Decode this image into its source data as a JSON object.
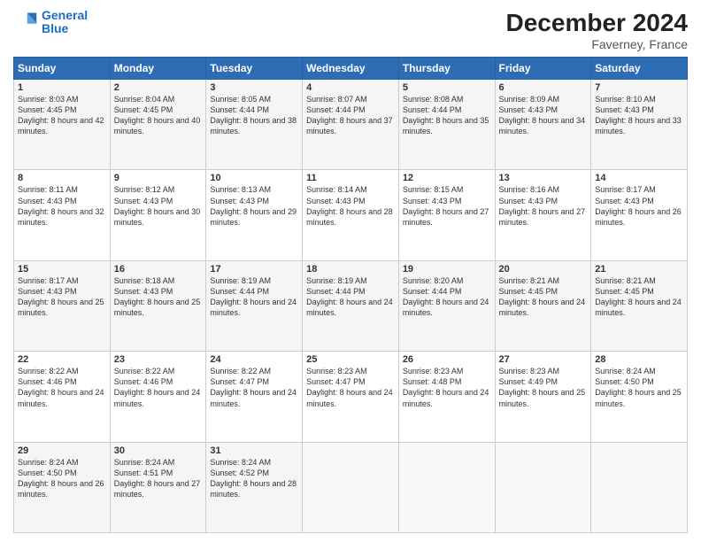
{
  "logo": {
    "line1": "General",
    "line2": "Blue"
  },
  "title": "December 2024",
  "subtitle": "Faverney, France",
  "header_days": [
    "Sunday",
    "Monday",
    "Tuesday",
    "Wednesday",
    "Thursday",
    "Friday",
    "Saturday"
  ],
  "weeks": [
    [
      {
        "day": "1",
        "sunrise": "Sunrise: 8:03 AM",
        "sunset": "Sunset: 4:45 PM",
        "daylight": "Daylight: 8 hours and 42 minutes."
      },
      {
        "day": "2",
        "sunrise": "Sunrise: 8:04 AM",
        "sunset": "Sunset: 4:45 PM",
        "daylight": "Daylight: 8 hours and 40 minutes."
      },
      {
        "day": "3",
        "sunrise": "Sunrise: 8:05 AM",
        "sunset": "Sunset: 4:44 PM",
        "daylight": "Daylight: 8 hours and 38 minutes."
      },
      {
        "day": "4",
        "sunrise": "Sunrise: 8:07 AM",
        "sunset": "Sunset: 4:44 PM",
        "daylight": "Daylight: 8 hours and 37 minutes."
      },
      {
        "day": "5",
        "sunrise": "Sunrise: 8:08 AM",
        "sunset": "Sunset: 4:44 PM",
        "daylight": "Daylight: 8 hours and 35 minutes."
      },
      {
        "day": "6",
        "sunrise": "Sunrise: 8:09 AM",
        "sunset": "Sunset: 4:43 PM",
        "daylight": "Daylight: 8 hours and 34 minutes."
      },
      {
        "day": "7",
        "sunrise": "Sunrise: 8:10 AM",
        "sunset": "Sunset: 4:43 PM",
        "daylight": "Daylight: 8 hours and 33 minutes."
      }
    ],
    [
      {
        "day": "8",
        "sunrise": "Sunrise: 8:11 AM",
        "sunset": "Sunset: 4:43 PM",
        "daylight": "Daylight: 8 hours and 32 minutes."
      },
      {
        "day": "9",
        "sunrise": "Sunrise: 8:12 AM",
        "sunset": "Sunset: 4:43 PM",
        "daylight": "Daylight: 8 hours and 30 minutes."
      },
      {
        "day": "10",
        "sunrise": "Sunrise: 8:13 AM",
        "sunset": "Sunset: 4:43 PM",
        "daylight": "Daylight: 8 hours and 29 minutes."
      },
      {
        "day": "11",
        "sunrise": "Sunrise: 8:14 AM",
        "sunset": "Sunset: 4:43 PM",
        "daylight": "Daylight: 8 hours and 28 minutes."
      },
      {
        "day": "12",
        "sunrise": "Sunrise: 8:15 AM",
        "sunset": "Sunset: 4:43 PM",
        "daylight": "Daylight: 8 hours and 27 minutes."
      },
      {
        "day": "13",
        "sunrise": "Sunrise: 8:16 AM",
        "sunset": "Sunset: 4:43 PM",
        "daylight": "Daylight: 8 hours and 27 minutes."
      },
      {
        "day": "14",
        "sunrise": "Sunrise: 8:17 AM",
        "sunset": "Sunset: 4:43 PM",
        "daylight": "Daylight: 8 hours and 26 minutes."
      }
    ],
    [
      {
        "day": "15",
        "sunrise": "Sunrise: 8:17 AM",
        "sunset": "Sunset: 4:43 PM",
        "daylight": "Daylight: 8 hours and 25 minutes."
      },
      {
        "day": "16",
        "sunrise": "Sunrise: 8:18 AM",
        "sunset": "Sunset: 4:43 PM",
        "daylight": "Daylight: 8 hours and 25 minutes."
      },
      {
        "day": "17",
        "sunrise": "Sunrise: 8:19 AM",
        "sunset": "Sunset: 4:44 PM",
        "daylight": "Daylight: 8 hours and 24 minutes."
      },
      {
        "day": "18",
        "sunrise": "Sunrise: 8:19 AM",
        "sunset": "Sunset: 4:44 PM",
        "daylight": "Daylight: 8 hours and 24 minutes."
      },
      {
        "day": "19",
        "sunrise": "Sunrise: 8:20 AM",
        "sunset": "Sunset: 4:44 PM",
        "daylight": "Daylight: 8 hours and 24 minutes."
      },
      {
        "day": "20",
        "sunrise": "Sunrise: 8:21 AM",
        "sunset": "Sunset: 4:45 PM",
        "daylight": "Daylight: 8 hours and 24 minutes."
      },
      {
        "day": "21",
        "sunrise": "Sunrise: 8:21 AM",
        "sunset": "Sunset: 4:45 PM",
        "daylight": "Daylight: 8 hours and 24 minutes."
      }
    ],
    [
      {
        "day": "22",
        "sunrise": "Sunrise: 8:22 AM",
        "sunset": "Sunset: 4:46 PM",
        "daylight": "Daylight: 8 hours and 24 minutes."
      },
      {
        "day": "23",
        "sunrise": "Sunrise: 8:22 AM",
        "sunset": "Sunset: 4:46 PM",
        "daylight": "Daylight: 8 hours and 24 minutes."
      },
      {
        "day": "24",
        "sunrise": "Sunrise: 8:22 AM",
        "sunset": "Sunset: 4:47 PM",
        "daylight": "Daylight: 8 hours and 24 minutes."
      },
      {
        "day": "25",
        "sunrise": "Sunrise: 8:23 AM",
        "sunset": "Sunset: 4:47 PM",
        "daylight": "Daylight: 8 hours and 24 minutes."
      },
      {
        "day": "26",
        "sunrise": "Sunrise: 8:23 AM",
        "sunset": "Sunset: 4:48 PM",
        "daylight": "Daylight: 8 hours and 24 minutes."
      },
      {
        "day": "27",
        "sunrise": "Sunrise: 8:23 AM",
        "sunset": "Sunset: 4:49 PM",
        "daylight": "Daylight: 8 hours and 25 minutes."
      },
      {
        "day": "28",
        "sunrise": "Sunrise: 8:24 AM",
        "sunset": "Sunset: 4:50 PM",
        "daylight": "Daylight: 8 hours and 25 minutes."
      }
    ],
    [
      {
        "day": "29",
        "sunrise": "Sunrise: 8:24 AM",
        "sunset": "Sunset: 4:50 PM",
        "daylight": "Daylight: 8 hours and 26 minutes."
      },
      {
        "day": "30",
        "sunrise": "Sunrise: 8:24 AM",
        "sunset": "Sunset: 4:51 PM",
        "daylight": "Daylight: 8 hours and 27 minutes."
      },
      {
        "day": "31",
        "sunrise": "Sunrise: 8:24 AM",
        "sunset": "Sunset: 4:52 PM",
        "daylight": "Daylight: 8 hours and 28 minutes."
      },
      null,
      null,
      null,
      null
    ]
  ]
}
